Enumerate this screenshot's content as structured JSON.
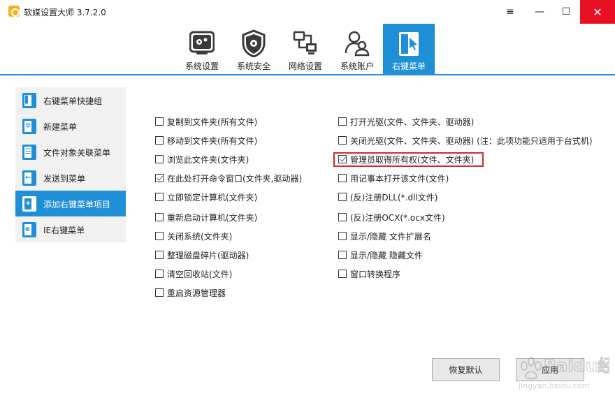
{
  "window": {
    "title": "软媒设置大师 3.7.2.0",
    "controls": {
      "menu": "≡",
      "minimize": "—",
      "maximize": "☐",
      "close": "✕"
    }
  },
  "toolbar": {
    "tabs": [
      {
        "label": "系统设置",
        "icon": "system-settings-icon",
        "active": false
      },
      {
        "label": "系统安全",
        "icon": "shield-icon",
        "active": false
      },
      {
        "label": "网络设置",
        "icon": "network-icon",
        "active": false
      },
      {
        "label": "系统账户",
        "icon": "users-icon",
        "active": false
      },
      {
        "label": "右键菜单",
        "icon": "cursor-icon",
        "active": true
      }
    ]
  },
  "sidebar": {
    "items": [
      {
        "label": "右键菜单快捷组",
        "glyph": "▌",
        "active": false
      },
      {
        "label": "新建菜单",
        "glyph": "✲",
        "active": false
      },
      {
        "label": "文件对象关联菜单",
        "glyph": "☰",
        "active": false
      },
      {
        "label": "发送到菜单",
        "glyph": "←",
        "active": false
      },
      {
        "label": "添加右键菜单项目",
        "glyph": "+",
        "active": true
      },
      {
        "label": "IE右键菜单",
        "glyph": "e",
        "active": false
      }
    ]
  },
  "options": {
    "left": [
      {
        "label": "复制到文件夹(所有文件)",
        "checked": false
      },
      {
        "label": "移动到文件夹(所有文件)",
        "checked": false
      },
      {
        "label": "浏览此文件夹(文件夹)",
        "checked": false
      },
      {
        "label": "在此处打开命令窗口(文件夹,驱动器)",
        "checked": true
      },
      {
        "label": "立即锁定计算机(文件夹)",
        "checked": false
      },
      {
        "label": "重新启动计算机(文件夹)",
        "checked": false
      },
      {
        "label": "关闭系统(文件夹)",
        "checked": false
      },
      {
        "label": "整理磁盘碎片(驱动器)",
        "checked": false
      },
      {
        "label": "清空回收站(文件)",
        "checked": false
      },
      {
        "label": "重启资源管理器",
        "checked": false
      }
    ],
    "right": [
      {
        "label": "打开光驱(文件、文件夹、驱动器)",
        "checked": false
      },
      {
        "label": "关闭光驱(文件、文件夹、驱动器) (注：此项功能只适用于台式机)",
        "checked": false
      },
      {
        "label": "管理员取得所有权(文件、文件夹)",
        "checked": true
      },
      {
        "label": "用记事本打开该文件(文件)",
        "checked": false
      },
      {
        "label": "(反)注册DLL(*.dll文件)",
        "checked": false
      },
      {
        "label": "(反)注册OCX(*.ocx文件)",
        "checked": false
      },
      {
        "label": "显示/隐藏 文件扩展名",
        "checked": false
      },
      {
        "label": "显示/隐藏 隐藏文件",
        "checked": false
      },
      {
        "label": "窗口转换程序",
        "checked": false
      }
    ]
  },
  "buttons": {
    "restore": "恢复默认",
    "apply": "应用"
  },
  "watermark": {
    "brand": "Baidu经验",
    "url": "jingyan.baidu.com"
  },
  "colors": {
    "accent": "#1f8fd8",
    "highlight": "#d9272e",
    "close": "#e81123"
  }
}
